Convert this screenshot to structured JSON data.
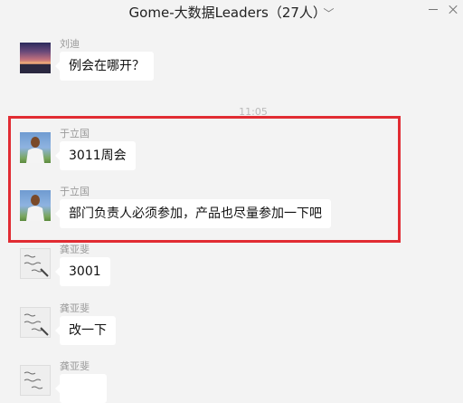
{
  "window": {
    "title": "Gome-大数据Leaders（27人）",
    "title_chevron": "﹀"
  },
  "time_separator": "11:05",
  "messages": [
    {
      "sender": "刘迪",
      "text": "例会在哪开？",
      "avatar": "sunset-avatar"
    },
    {
      "sender": "于立国",
      "text": "3011周会",
      "avatar": "person-avatar"
    },
    {
      "sender": "于立国",
      "text": "部门负责人必须参加，产品也尽量参加一下吧",
      "avatar": "person-avatar"
    },
    {
      "sender": "龚亚斐",
      "text": "3001",
      "avatar": "handwriting-avatar"
    },
    {
      "sender": "龚亚斐",
      "text": "改一下",
      "avatar": "handwriting-avatar"
    },
    {
      "sender": "龚亚斐",
      "text": "",
      "avatar": "handwriting-avatar"
    }
  ],
  "colors": {
    "highlight": "#e12c33",
    "background": "#f3f3f3",
    "bubble": "#ffffff"
  }
}
